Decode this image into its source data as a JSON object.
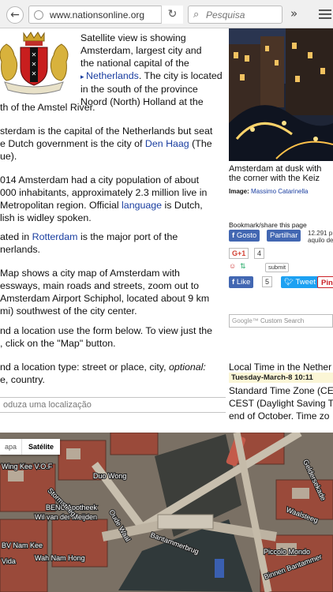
{
  "browser": {
    "url": "www.nationsonline.org",
    "search_placeholder": "Pesquisa",
    "overflow_glyph": "»"
  },
  "left": {
    "para1": [
      "Satellite view is showing",
      "Amsterdam, largest city and",
      "the national capital of the",
      "Netherlands",
      ". The city is located",
      "in the south of the province",
      "Noord (North) Holland at the",
      "th of the Amstel River."
    ],
    "para2": [
      "sterdam is the capital of the Netherlands but seat",
      "e Dutch government is the city of ",
      "Den Haag",
      " (The",
      "ue)."
    ],
    "para3": [
      "014 Amsterdam had a city population of about",
      "000 inhabitants, approximately 2.3 million live in",
      "Metropolitan region. Official ",
      "language",
      " is Dutch,",
      "lish is widley spoken."
    ],
    "para4": [
      "ated in ",
      "Rotterdam",
      " is the major port of the",
      "nerlands."
    ],
    "para5": [
      "Map shows a city map of Amsterdam with",
      "essways, main roads and streets, zoom out to",
      "Amsterdam Airport Schiphol, located about 9 km",
      "mi) southwest of the city center."
    ],
    "para6": [
      "nd a location use the form below. To view just the",
      ", click on the \"Map\" button."
    ],
    "para7": [
      "nd a location type: street or place, city, ",
      "optional:",
      "e, country."
    ],
    "location_placeholder": "oduza uma localização"
  },
  "right": {
    "caption": [
      "Amsterdam at dusk with",
      "the corner with the Keiz"
    ],
    "image_credit_label": "Image: ",
    "image_credit_name": "Massimo Catarinella",
    "bookmark_heading": "Bookmark/share this page",
    "gosto": "Gosto",
    "partilhar": "Partilhar",
    "like_count_text": [
      "12.291 p",
      "aquilo de"
    ],
    "gplus_label": "G+1",
    "gplus_count": "4",
    "submit_label": "submit",
    "like_label": "Like",
    "like_count": "5",
    "tweet_label": "Tweet",
    "pin_label": "Pin",
    "search_label": "Custom Search",
    "time_heading": "Local Time in the Nether",
    "time_bar": "Tuesday-March-8  10:11",
    "time_text": [
      "Standard Time Zone (CE",
      "CEST (Daylight Saving Ti",
      "end of October. Time zo"
    ]
  },
  "map": {
    "tab_mapa": "apa",
    "tab_satellite": "Satélite",
    "labels": [
      "Wing Kee V.O.F",
      "Duo Wong",
      "BENU Apotheek",
      "Wil van der Meijden",
      "BV Nam Kee",
      "Wah Nam Hong",
      "Vida",
      "Bantammerbrug",
      "Piccolo Mondo",
      "Waalsteeg",
      "Binnen Bantammer",
      "Geldersekade",
      "Stormsteeg",
      "Oude Waal"
    ]
  }
}
